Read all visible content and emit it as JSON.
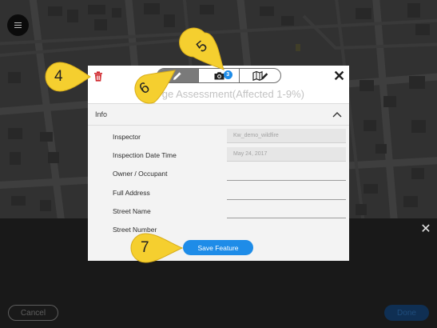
{
  "colors": {
    "accent": "#1e8ce8",
    "callout": "#f5cf2f",
    "delete": "#d0282d",
    "done_button": "#0f2f53"
  },
  "icons": {
    "menu": "hamburger-icon",
    "delete": "trash-icon",
    "edit_tab": "pencil-icon",
    "photo_tab": "camera-icon",
    "map_tab": "map-edit-icon",
    "close": "close-icon",
    "collapse": "chevron-up-icon",
    "sheet_close": "close-icon"
  },
  "modal": {
    "title": "ge Assessment(Affected 1-9%)",
    "close_label": "✕",
    "tabs": [
      {
        "name": "edit",
        "active": true
      },
      {
        "name": "photos",
        "badge": "3",
        "active": false
      },
      {
        "name": "map",
        "active": false
      }
    ],
    "section": {
      "label": "Info"
    },
    "fields": [
      {
        "label": "Inspector",
        "value": "Kw_demo_wildfire"
      },
      {
        "label": "Inspection Date Time",
        "value": "May 24, 2017"
      },
      {
        "label": "Owner / Occupant",
        "value": ""
      },
      {
        "label": "Full Address",
        "value": ""
      },
      {
        "label": "Street Name",
        "value": ""
      },
      {
        "label": "Street Number",
        "value": ""
      }
    ],
    "save_label": "Save Feature"
  },
  "sheet": {
    "close_label": "✕",
    "cancel_label": "Cancel",
    "done_label": "Done"
  },
  "callouts": [
    {
      "number": "4"
    },
    {
      "number": "5"
    },
    {
      "number": "6"
    },
    {
      "number": "7"
    }
  ]
}
